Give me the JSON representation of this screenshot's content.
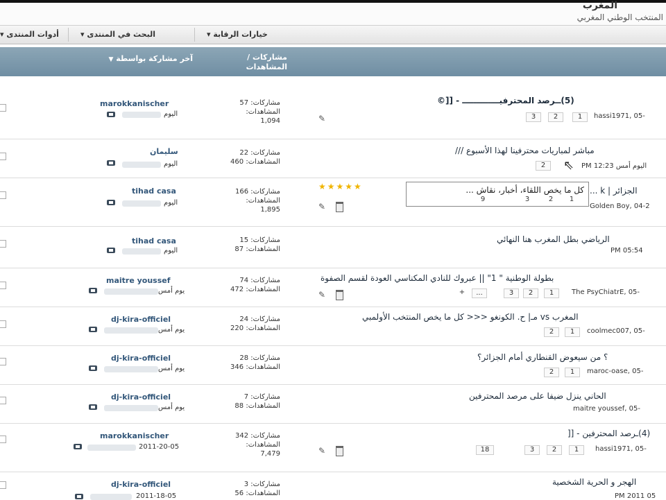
{
  "header": {
    "site_title": "المغرب",
    "site_sub": "المنتخب الوطني المغربي"
  },
  "toolbar": {
    "item1": "أدوات المنتدى",
    "item2": "البحث في المنتدى",
    "item3": "خيارات الرقابة"
  },
  "columns": {
    "last_post": "آخر مشاركة بواسطة",
    "stats": "مشاركات / المشاهدات"
  },
  "labels": {
    "posts": "مشاركات:",
    "views": "المشاهدات:"
  },
  "rows": [
    {
      "user": "marokkanischer",
      "date": "اليوم",
      "posts": "57",
      "views": "1,094",
      "title": "(5)ــرصد المحترفيـــــــــــــ - [[©",
      "meta": "hassi1971, 05-",
      "pages": [
        "3",
        "2",
        "1"
      ]
    },
    {
      "user": "سليمان",
      "date": "اليوم",
      "posts": "22",
      "views": "460",
      "title": "مباشر لمباريات محترفينا لهذا الأسبوع ///",
      "meta": "PM 12:23 اليوم أمس",
      "pages": [
        "2"
      ]
    },
    {
      "user": "tihad casa",
      "date": "اليوم",
      "posts": "166",
      "views": "1,895",
      "title": "الجزائر | k ...",
      "meta": "Golden Boy, 04-2",
      "pages": [
        "9",
        "3",
        "2",
        "1"
      ]
    },
    {
      "user": "tihad casa",
      "date": "اليوم",
      "posts": "15",
      "views": "87",
      "title": "الرياضي بطل المغرب هنا النهائي",
      "meta": "PM 05:54",
      "pages": []
    },
    {
      "user": "maitre youssef",
      "date": "يوم أمس",
      "posts": "74",
      "views": "472",
      "title": "بطولة الوطنية \" 1\" || عبروك للنادي المكناسي العودة لقسم الصفوة",
      "meta": "The PsyChiatrE, 05-",
      "pages": [
        "3",
        "2",
        "1"
      ]
    },
    {
      "user": "dj-kira-officiel",
      "date": "يوم أمس",
      "posts": "24",
      "views": "220",
      "title": "المغرب vs مـ| ح. الكونغو <<< كل ما يخص المنتخب الأولمبي",
      "meta": "coolmec007, 05-",
      "pages": [
        "2",
        "1"
      ]
    },
    {
      "user": "dj-kira-officiel",
      "date": "يوم أمس",
      "posts": "28",
      "views": "346",
      "title": "؟ من سيعوض القنطاري أمام الجزائر؟",
      "meta": "maroc-oase, 05-",
      "pages": [
        "2",
        "1"
      ]
    },
    {
      "user": "dj-kira-officiel",
      "date": "يوم أمس",
      "posts": "7",
      "views": "88",
      "title": "الحاني ينزل ضيفا على مرصد المحترفين",
      "meta": "maitre youssef, 05-",
      "pages": []
    },
    {
      "user": "marokkanischer",
      "date": "2011-20-05",
      "posts": "342",
      "views": "7,479",
      "title": "(4)ـرصد المحترفين - [[",
      "meta": "hassi1971, 05-",
      "pages": [
        "18",
        "3",
        "2",
        "1"
      ]
    },
    {
      "user": "dj-kira-officiel",
      "date": "2011-18-05",
      "posts": "3",
      "views": "56",
      "title": "الهجر و الحرية الشخصية",
      "meta": "PM 2011 05",
      "pages": []
    }
  ],
  "tooltip": {
    "text": "كل ما يخص اللقاء، أخبار، نقاش ..."
  },
  "misc": {
    "stars": "★★★★★",
    "next_arrow": "+",
    "ellipsis": "..."
  }
}
